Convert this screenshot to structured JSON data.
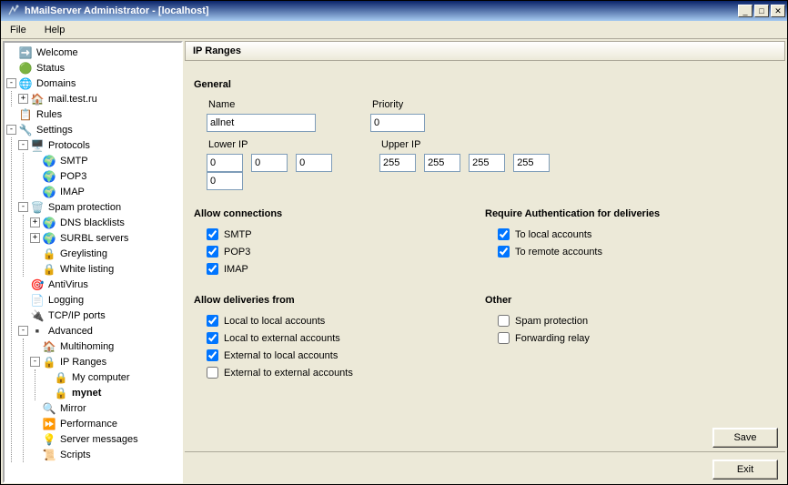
{
  "window": {
    "title": "hMailServer Administrator - [localhost]"
  },
  "menu": {
    "file": "File",
    "help": "Help"
  },
  "winbtns": {
    "min": "_",
    "max": "□",
    "close": "✕"
  },
  "tree": {
    "welcome": "Welcome",
    "status": "Status",
    "domains": "Domains",
    "mail_test": "mail.test.ru",
    "rules": "Rules",
    "settings": "Settings",
    "protocols": "Protocols",
    "smtp": "SMTP",
    "pop3": "POP3",
    "imap": "IMAP",
    "spam": "Spam protection",
    "dnsbl": "DNS blacklists",
    "surbl": "SURBL servers",
    "greylisting": "Greylisting",
    "whitelisting": "White listing",
    "antivirus": "AntiVirus",
    "logging": "Logging",
    "tcpip": "TCP/IP ports",
    "advanced": "Advanced",
    "multihoming": "Multihoming",
    "ipranges": "IP Ranges",
    "mycomputer": "My computer",
    "mynet": "mynet",
    "mirror": "Mirror",
    "performance": "Performance",
    "servermsg": "Server messages",
    "scripts": "Scripts"
  },
  "panel": {
    "title": "IP Ranges"
  },
  "general": {
    "heading": "General",
    "name_label": "Name",
    "name_value": "allnet",
    "priority_label": "Priority",
    "priority_value": "0",
    "lowerip_label": "Lower IP",
    "lowerip": [
      "0",
      "0",
      "0",
      "0"
    ],
    "upperip_label": "Upper IP",
    "upperip": [
      "255",
      "255",
      "255",
      "255"
    ]
  },
  "allowconn": {
    "heading": "Allow connections",
    "smtp": "SMTP",
    "pop3": "POP3",
    "imap": "IMAP"
  },
  "reqauth": {
    "heading": "Require Authentication for deliveries",
    "local": "To local accounts",
    "remote": "To remote accounts"
  },
  "allowdeliv": {
    "heading": "Allow deliveries from",
    "ll": "Local to local accounts",
    "le": "Local to external accounts",
    "el": "External to local accounts",
    "ee": "External to external accounts"
  },
  "other": {
    "heading": "Other",
    "spam": "Spam protection",
    "fwd": "Forwarding relay"
  },
  "buttons": {
    "save": "Save",
    "exit": "Exit"
  }
}
